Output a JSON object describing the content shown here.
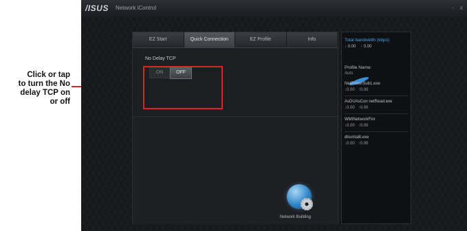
{
  "callout": {
    "line1": "Click or tap",
    "line2": "to turn the No",
    "line3": "delay TCP on",
    "line4": "or off"
  },
  "window": {
    "logo": "/ISUS",
    "title": "Network iControl",
    "controls": [
      "-",
      "x"
    ]
  },
  "tabs": [
    {
      "label": "EZ Start",
      "active": false
    },
    {
      "label": "Quick Connection",
      "active": true
    },
    {
      "label": "EZ Profile",
      "active": false
    },
    {
      "label": "Info",
      "active": false
    }
  ],
  "no_delay": {
    "label": "No Delay TCP",
    "on_label": "ON",
    "off_label": "OFF",
    "state": "OFF"
  },
  "network_building": {
    "label": "Network Building"
  },
  "sidebar": {
    "bandwidth_title": "Total bandwidth (kbps)",
    "bandwidth_down": "0.00",
    "bandwidth_up": "0.00",
    "profile_title": "Profile Name:",
    "profile_sub": "Auto",
    "profiles": [
      {
        "name": "NetPowerSub1.exe",
        "down": "0.00",
        "up": "0.00"
      },
      {
        "name": "AsDUAsCon netRead.exe",
        "down": "0.00",
        "up": "0.00"
      },
      {
        "name": "WMINetworkFinr",
        "down": "0.00",
        "up": "0.00"
      },
      {
        "name": "dbsmtallt.exe",
        "down": "0.00",
        "up": "0.00"
      }
    ]
  },
  "colors": {
    "highlight": "#d8262b",
    "accent": "#4aa3e8"
  }
}
